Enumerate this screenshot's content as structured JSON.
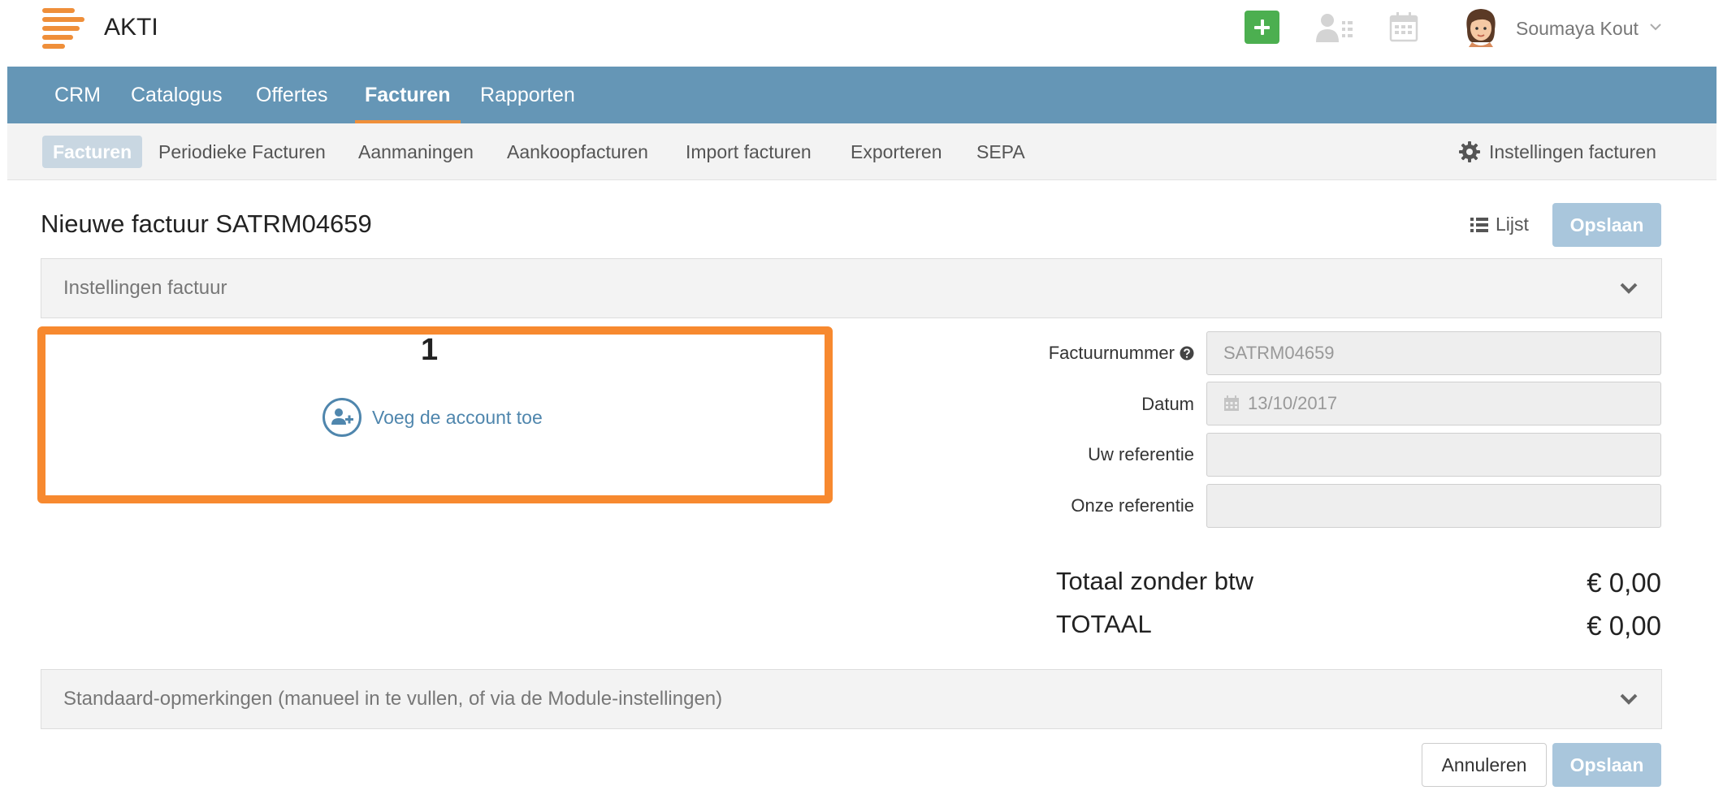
{
  "header": {
    "app_name": "AKTI",
    "user_name": "Soumaya Kout"
  },
  "main_nav": {
    "tabs": [
      {
        "label": "CRM"
      },
      {
        "label": "Catalogus"
      },
      {
        "label": "Offertes"
      },
      {
        "label": "Facturen",
        "active": true
      },
      {
        "label": "Rapporten"
      }
    ]
  },
  "sub_nav": {
    "items": [
      {
        "label": "Facturen",
        "active": true
      },
      {
        "label": "Periodieke Facturen"
      },
      {
        "label": "Aanmaningen"
      },
      {
        "label": "Aankoopfacturen"
      },
      {
        "label": "Import facturen"
      },
      {
        "label": "Exporteren"
      },
      {
        "label": "SEPA"
      }
    ],
    "settings_label": "Instellingen facturen"
  },
  "page": {
    "title": "Nieuwe factuur SATRM04659",
    "list_label": "Lijst",
    "save_label": "Opslaan",
    "cancel_label": "Annuleren"
  },
  "panels": {
    "settings_label": "Instellingen factuur",
    "remarks_label": "Standaard-opmerkingen (manueel in te vullen, of via de Module-instellingen)"
  },
  "account": {
    "step_number": "1",
    "add_label": "Voeg de account toe"
  },
  "form": {
    "invoice_number": {
      "label": "Factuurnummer",
      "value": "SATRM04659"
    },
    "date": {
      "label": "Datum",
      "value": "13/10/2017"
    },
    "your_reference": {
      "label": "Uw referentie",
      "value": ""
    },
    "our_reference": {
      "label": "Onze referentie",
      "value": ""
    }
  },
  "totals": {
    "subtotal_label": "Totaal zonder btw",
    "subtotal_value": "€ 0,00",
    "total_label": "TOTAAL",
    "total_value": "€ 0,00"
  },
  "colors": {
    "nav_bg": "#6596b6",
    "accent_orange": "#f7892f",
    "add_green": "#4caf50",
    "save_button": "#a9c6dc",
    "link_blue": "#4f86ad"
  }
}
